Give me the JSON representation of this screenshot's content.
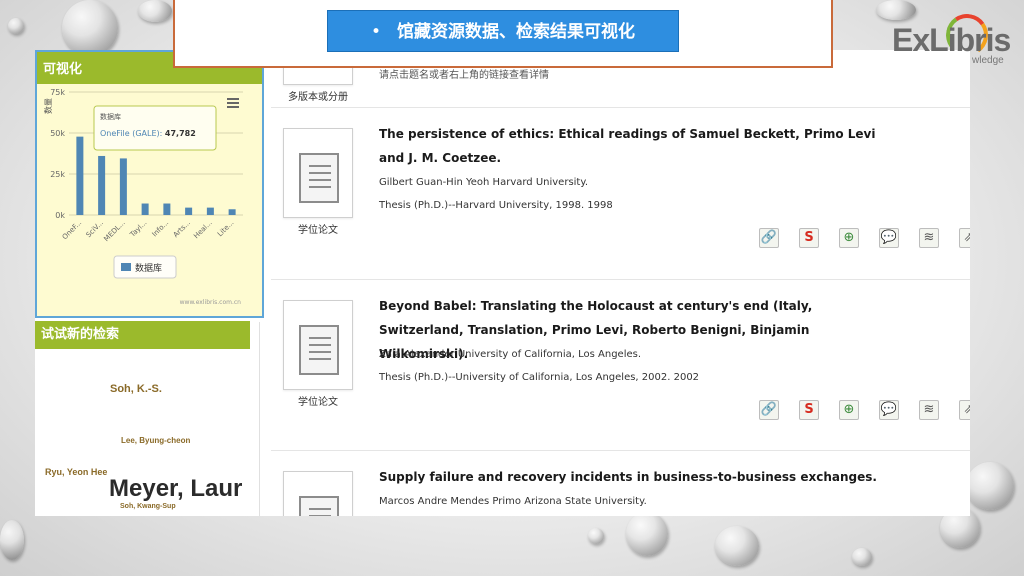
{
  "header": {
    "bullet": "•",
    "title": "馆藏资源数据、检索结果可视化"
  },
  "logo": {
    "text": "ExLibris",
    "sub": "wledge"
  },
  "viz": {
    "heading": "可视化",
    "menu_icon": "hamburger-icon",
    "tooltip_title": "数据库",
    "tooltip_series": "OneFile (GALE):",
    "tooltip_value": "47,782",
    "legend": "数据库",
    "credit": "www.exlibris.com.cn",
    "ylabel": "数量"
  },
  "chart_data": {
    "type": "bar",
    "categories": [
      "OneF...",
      "SciV...",
      "MEDL...",
      "Tayl...",
      "Info...",
      "Arts...",
      "Heal...",
      "Lite..."
    ],
    "series": [
      {
        "name": "数据库",
        "values": [
          47782,
          36000,
          34500,
          7000,
          7000,
          4500,
          4500,
          3500
        ]
      }
    ],
    "ytick_labels": [
      "0k",
      "25k",
      "50k",
      "75k"
    ],
    "ylabel": "数量",
    "ylim": [
      0,
      75000
    ],
    "legend": "bottom",
    "color": "#4f86b4"
  },
  "new_search": {
    "heading": "试试新的检索",
    "names": [
      "Soh, K.-S.",
      "Lee, Byung-cheon",
      "Ryu, Yeon Hee",
      "Meyer, Laur",
      "Soh, Kwang-Sup"
    ]
  },
  "results": {
    "top": {
      "thumb_label": "多版本或分册",
      "hint": "请点击题名或者右上角的链接查看详情"
    },
    "items": [
      {
        "title": "The persistence of ethics: Ethical readings of Samuel Beckett, Primo Levi and J. M. Coetzee.",
        "author": "Gilbert Guan-Hin Yeoh Harvard University.",
        "note": "Thesis (Ph.D.)--Harvard University, 1998. 1998",
        "thumb_label": "学位论文"
      },
      {
        "title": "Beyond Babel: Translating the Holocaust at century's end (Italy, Switzerland, Translation, Primo Levi, Roberto Benigni, Binjamin Wilkomirski).",
        "author": "Zaia Alexander University of California, Los Angeles.",
        "note": "Thesis (Ph.D.)--University of California, Los Angeles, 2002. 2002",
        "thumb_label": "学位论文"
      },
      {
        "title": "Supply failure and recovery incidents in business-to-business exchanges.",
        "author": "Marcos Andre Mendes Primo Arizona State University.",
        "note": "",
        "thumb_label": ""
      }
    ],
    "action_icons": [
      "link-icon",
      "citation-icon",
      "zoom-icon",
      "comment-icon",
      "layers-icon",
      "export-icon"
    ],
    "action_glyphs": [
      "🔗",
      "S",
      "⊕",
      "💬",
      "≋",
      "⇗"
    ]
  }
}
